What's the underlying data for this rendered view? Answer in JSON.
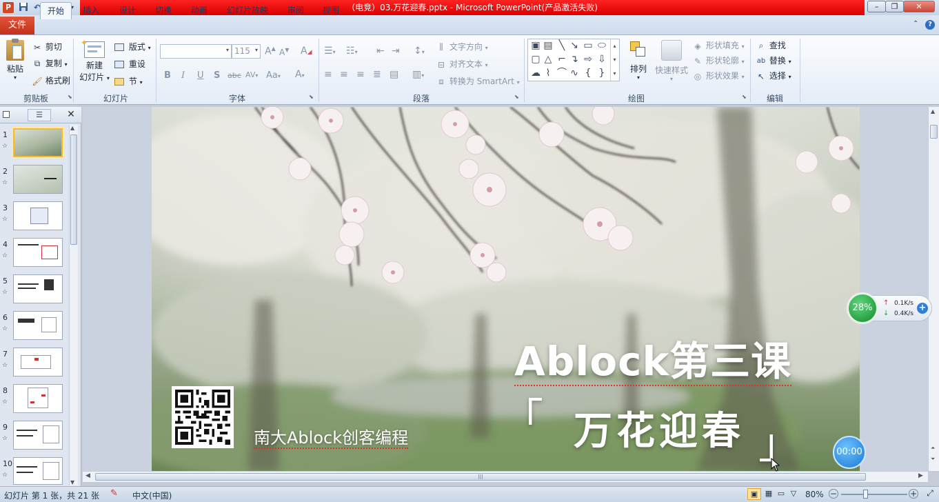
{
  "window": {
    "title": "（电竞）03.万花迎春.pptx - Microsoft PowerPoint(产品激活失败)",
    "controls": [
      "–",
      "❐",
      "✕"
    ]
  },
  "quick_access": [
    "save-icon",
    "undo-icon",
    "redo-icon"
  ],
  "tabs": {
    "file": "文件",
    "items": [
      "开始",
      "插入",
      "设计",
      "切换",
      "动画",
      "幻灯片放映",
      "审阅",
      "视图"
    ],
    "active": "开始"
  },
  "ribbon": {
    "clipboard": {
      "label": "剪贴板",
      "paste": "粘贴",
      "cut": "剪切",
      "copy": "复制",
      "format_painter": "格式刷"
    },
    "slides": {
      "label": "幻灯片",
      "new_slide_1": "新建",
      "new_slide_2": "幻灯片",
      "layout": "版式",
      "reset": "重设",
      "section": "节"
    },
    "font": {
      "label": "字体",
      "font_name": "",
      "font_size": "115",
      "grow": "A",
      "shrink": "A",
      "clear": "A",
      "bold": "B",
      "italic": "I",
      "underline": "U",
      "shadow": "S",
      "strike": "abc",
      "spacing": "AV",
      "case": "Aa",
      "color": "A"
    },
    "paragraph": {
      "label": "段落",
      "text_direction": "文字方向",
      "align_text": "对齐文本",
      "smartart": "转换为 SmartArt"
    },
    "drawing": {
      "label": "绘图",
      "arrange": "排列",
      "quick_styles": "快速样式",
      "shape_fill": "形状填充",
      "shape_outline": "形状轮廓",
      "shape_effects": "形状效果"
    },
    "editing": {
      "label": "编辑",
      "find": "查找",
      "replace": "替换",
      "select": "选择"
    }
  },
  "thumbnails": [
    "1",
    "2",
    "3",
    "4",
    "5",
    "6",
    "7",
    "8",
    "9",
    "10"
  ],
  "slide": {
    "title": "Ablock第三课",
    "subtitle": "万花迎春",
    "bracket_open": "「",
    "bracket_close": "」",
    "org": "南大Ablock创客编程"
  },
  "widgets": {
    "cpu_percent": "28%",
    "upload": "0.1K/s",
    "download": "0.4K/s",
    "timer": "00:00"
  },
  "status": {
    "slide_info": "幻灯片 第 1 张，共 21 张",
    "language": "中文(中国)",
    "zoom": "80%"
  },
  "colors": {
    "title_bar_accent": "#e00000",
    "file_tab": "#d6432a",
    "ribbon_bg": "#eef3f9",
    "selection": "#f5b93a",
    "cpu_widget": "#22a845",
    "timer_widget": "#2b8ee8"
  }
}
